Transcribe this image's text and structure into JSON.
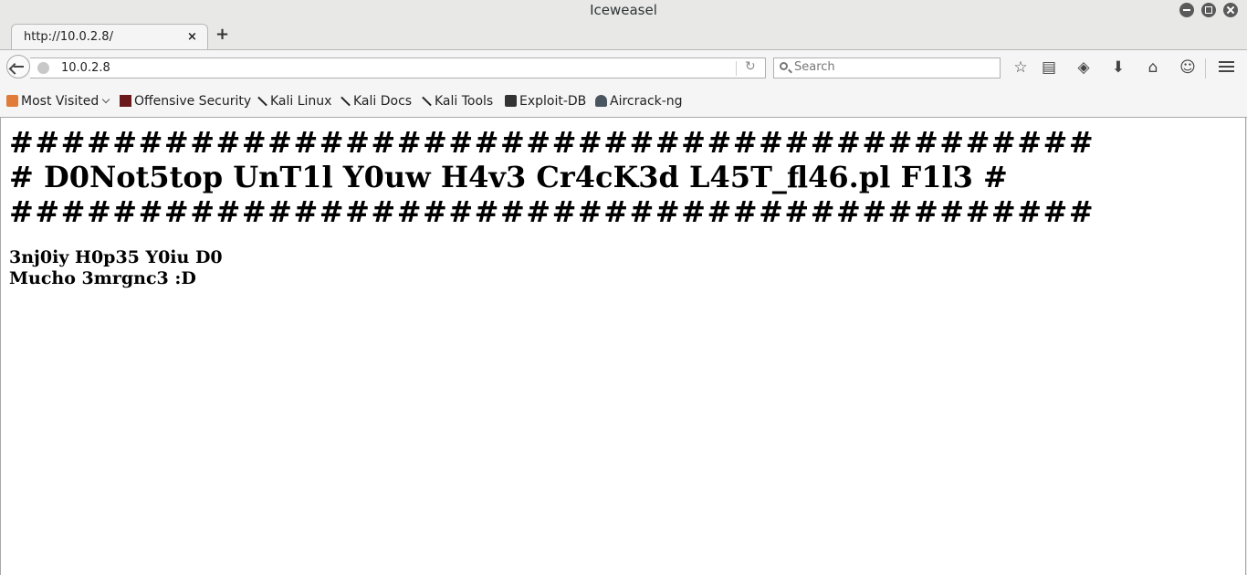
{
  "window": {
    "title": "Iceweasel"
  },
  "tabs": [
    {
      "label": "http://10.0.2.8/",
      "close": "×"
    }
  ],
  "newtab": {
    "label": "+"
  },
  "navbar": {
    "url": "10.0.2.8",
    "search_placeholder": "Search"
  },
  "toolbar_icons": [
    "bookmark-star-icon",
    "reading-list-icon",
    "pocket-icon",
    "download-icon",
    "home-icon",
    "hello-icon",
    "menu-icon"
  ],
  "bookmarks": [
    {
      "label": "Most Visited",
      "icon": "folder-icon"
    },
    {
      "label": "Offensive Security",
      "icon": "offsec-icon"
    },
    {
      "label": "Kali Linux",
      "icon": "kali-dragon-icon"
    },
    {
      "label": "Kali Docs",
      "icon": "kali-dragon-icon"
    },
    {
      "label": "Kali Tools",
      "icon": "kali-dragon-icon"
    },
    {
      "label": "Exploit-DB",
      "icon": "exploitdb-icon"
    },
    {
      "label": "Aircrack-ng",
      "icon": "aircrack-icon"
    }
  ],
  "page": {
    "line1": "##########################################",
    "line2": "# D0Not5top UnT1l Y0uw H4v3 Cr4cK3d L45T_fl46.pl F1l3 #",
    "line3": "##########################################",
    "line4": "3nj0iy H0p35 Y0iu D0",
    "line5": "Mucho 3mrgnc3 :D"
  },
  "colors": {
    "chrome_bg": "#e8e8e7",
    "toolbar_bg": "#f5f5f5",
    "page_bg": "#ffffff",
    "text": "#000000"
  }
}
